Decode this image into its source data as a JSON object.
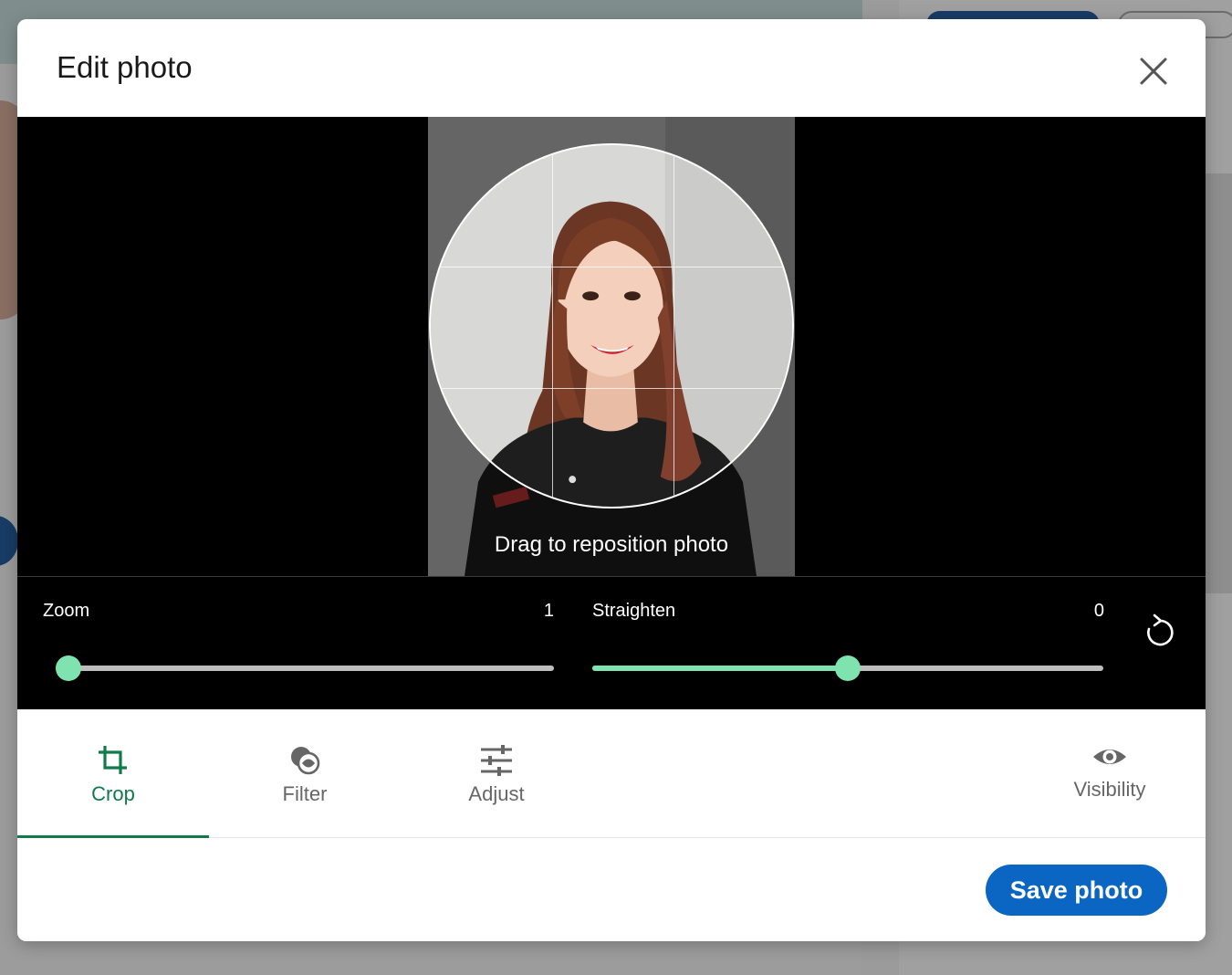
{
  "modal": {
    "title": "Edit photo"
  },
  "stage": {
    "hint": "Drag to reposition photo"
  },
  "controls": {
    "zoom": {
      "label": "Zoom",
      "value": "1",
      "fraction": 0.0
    },
    "straighten": {
      "label": "Straighten",
      "value": "0",
      "fraction": 0.5
    }
  },
  "tabs": [
    {
      "label": "Crop",
      "icon": "crop-icon",
      "active": true
    },
    {
      "label": "Filter",
      "icon": "filter-icon",
      "active": false
    },
    {
      "label": "Adjust",
      "icon": "adjust-icon",
      "active": false
    },
    {
      "label": "Visibility",
      "icon": "eye-icon",
      "active": false
    }
  ],
  "footer": {
    "save_label": "Save photo"
  },
  "colors": {
    "accent_green": "#117a4a",
    "slider_green": "#7fe3b0",
    "primary_blue": "#0a66c2"
  }
}
